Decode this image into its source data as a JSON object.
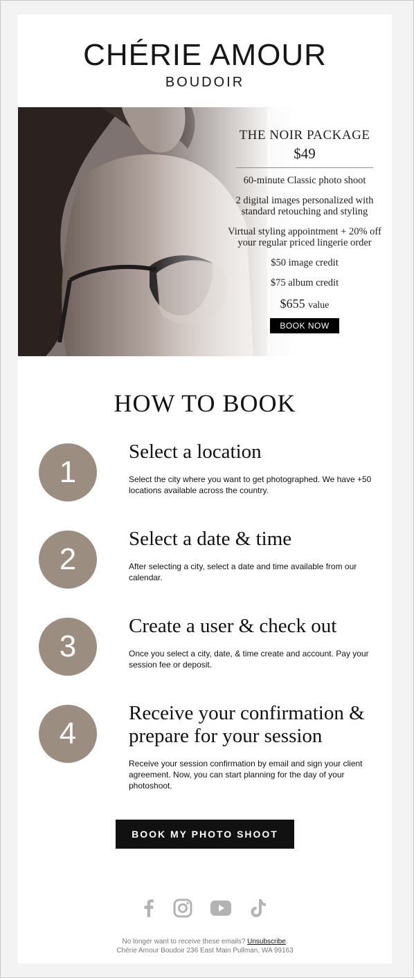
{
  "brand": {
    "name": "CHÉRIE AMOUR",
    "sub": "BOUDOIR"
  },
  "package": {
    "title": "THE NOIR PACKAGE",
    "price": "$49",
    "features": [
      "60-minute Classic photo shoot",
      "2 digital images personalized with standard retouching and styling",
      "Virtual styling appointment + 20% off your regular priced lingerie order",
      "$50 image credit",
      "$75 album credit"
    ],
    "value_amount": "$655",
    "value_label": "value",
    "button": "BOOK NOW"
  },
  "how_to_book": {
    "title": "HOW TO BOOK",
    "steps": [
      {
        "number": "1",
        "title": "Select a location",
        "text": "Select the city where you want to get photographed. We have +50 locations available across the country."
      },
      {
        "number": "2",
        "title": "Select a date & time",
        "text": "After selecting a city, select a date and time available from our calendar."
      },
      {
        "number": "3",
        "title": "Create a user & check out",
        "text": "Once you select a city, date, & time create and account. Pay your session fee or deposit."
      },
      {
        "number": "4",
        "title": "Receive your confirmation & prepare for your session",
        "text": "Receive your session confirmation by email and sign your client agreement. Now, you can start planning for the day of your photoshoot."
      }
    ]
  },
  "cta": "BOOK MY PHOTO SHOOT",
  "social": [
    "facebook-icon",
    "instagram-icon",
    "youtube-icon",
    "tiktok-icon"
  ],
  "footer": {
    "prompt": "No longer want to receive these emails?",
    "unsubscribe": "Unsubscribe",
    "period": ".",
    "address": "Chérie Amour Boudoir 236 East Main Pullman, WA 99163"
  },
  "colors": {
    "step_circle": "#9c8d81",
    "button_bg": "#111111",
    "social_icon": "#b3b3b3"
  }
}
